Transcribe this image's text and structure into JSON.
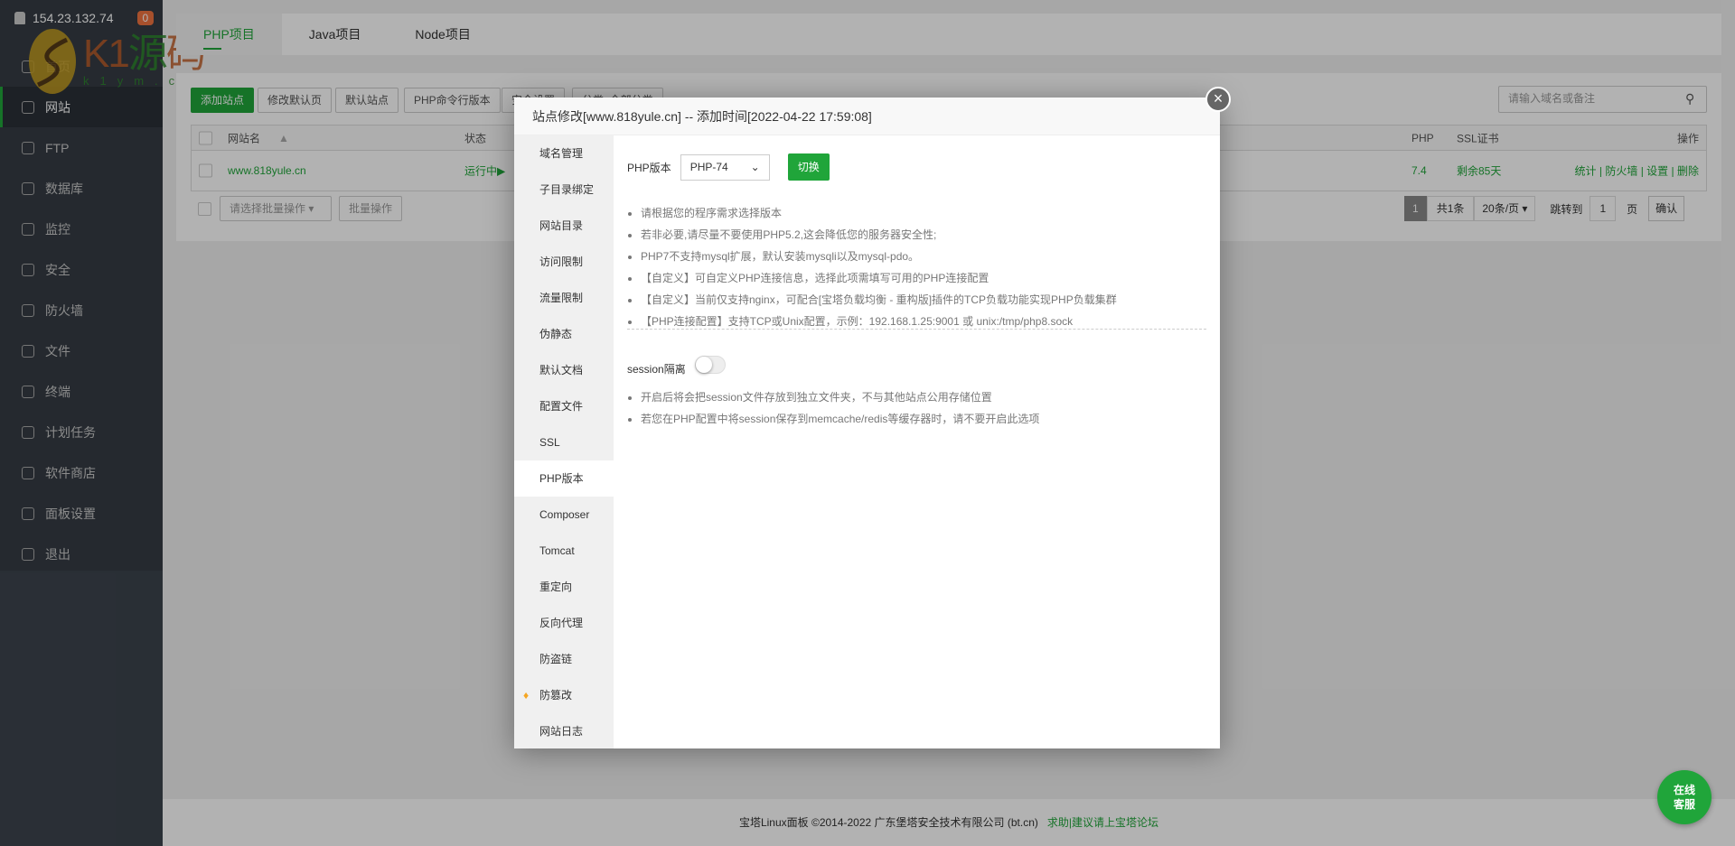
{
  "sidebar": {
    "ip": "154.23.132.74",
    "badge": "0",
    "items": [
      {
        "label": "首页",
        "icon": "home-icon"
      },
      {
        "label": "网站",
        "icon": "globe-icon",
        "active": true
      },
      {
        "label": "FTP",
        "icon": "ftp-icon"
      },
      {
        "label": "数据库",
        "icon": "database-icon"
      },
      {
        "label": "监控",
        "icon": "monitor-icon"
      },
      {
        "label": "安全",
        "icon": "shield-icon"
      },
      {
        "label": "防火墙",
        "icon": "firewall-icon"
      },
      {
        "label": "文件",
        "icon": "folder-icon"
      },
      {
        "label": "终端",
        "icon": "terminal-icon"
      },
      {
        "label": "计划任务",
        "icon": "calendar-icon"
      },
      {
        "label": "软件商店",
        "icon": "apps-icon"
      },
      {
        "label": "面板设置",
        "icon": "gear-icon"
      },
      {
        "label": "退出",
        "icon": "logout-icon"
      }
    ]
  },
  "watermark": {
    "brand": "K1源码",
    "domain": "k1ym.com"
  },
  "tabs": [
    "PHP项目",
    "Java项目",
    "Node项目"
  ],
  "toolbar": {
    "add": "添加站点",
    "edit_default": "修改默认页",
    "default_site": "默认站点",
    "php_cli": "PHP命令行版本",
    "security": "安全设置",
    "category": "分类: 全部分类",
    "search_placeholder": "请输入域名或备注"
  },
  "table": {
    "headers": {
      "name": "网站名",
      "status": "状态",
      "php": "PHP",
      "ssl": "SSL证书",
      "ops": "操作"
    },
    "rows": [
      {
        "name": "www.818yule.cn",
        "status": "运行中▶",
        "php": "7.4",
        "ssl": "剩余85天",
        "ops": [
          "统计",
          "防火墙",
          "设置",
          "删除"
        ]
      }
    ]
  },
  "batch": {
    "placeholder": "请选择批量操作",
    "button": "批量操作"
  },
  "pagination": {
    "current": "1",
    "total": "共1条",
    "per_page": "20条/页",
    "jump_label": "跳转到",
    "jump_value": "1",
    "page_unit": "页",
    "confirm": "确认"
  },
  "dialog": {
    "title": "站点修改[www.818yule.cn] -- 添加时间[2022-04-22 17:59:08]",
    "menu": [
      "域名管理",
      "子目录绑定",
      "网站目录",
      "访问限制",
      "流量限制",
      "伪静态",
      "默认文档",
      "配置文件",
      "SSL",
      "PHP版本",
      "Composer",
      "Tomcat",
      "重定向",
      "反向代理",
      "防盗链",
      "防篡改",
      "网站日志"
    ],
    "php_label": "PHP版本",
    "php_value": "PHP-74",
    "switch": "切换",
    "tips": [
      "请根据您的程序需求选择版本",
      "若非必要,请尽量不要使用PHP5.2,这会降低您的服务器安全性;",
      "PHP7不支持mysql扩展，默认安装mysqli以及mysql-pdo。",
      "【自定义】可自定义PHP连接信息，选择此项需填写可用的PHP连接配置",
      "【自定义】当前仅支持nginx，可配合[宝塔负载均衡 - 重构版]插件的TCP负载功能实现PHP负载集群",
      "【PHP连接配置】支持TCP或Unix配置，示例：192.168.1.25:9001 或 unix:/tmp/php8.sock"
    ],
    "session_label": "session隔离",
    "session_enabled": false,
    "session_tips": [
      "开启后将会把session文件存放到独立文件夹，不与其他站点公用存储位置",
      "若您在PHP配置中将session保存到memcache/redis等缓存器时，请不要开启此选项"
    ]
  },
  "footer": {
    "copyright": "宝塔Linux面板 ©2014-2022 广东堡塔安全技术有限公司 (bt.cn)",
    "link": "求助|建议请上宝塔论坛"
  },
  "chat": {
    "line1": "在线",
    "line2": "客服"
  },
  "colors": {
    "accent": "#20a53a",
    "sidebar": "#3c444d"
  }
}
